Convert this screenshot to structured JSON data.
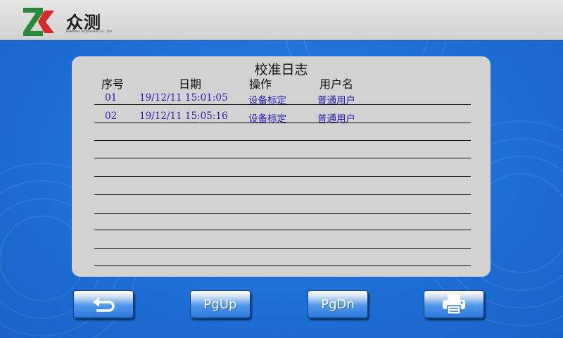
{
  "header": {
    "brand_name": "众测",
    "brand_sub": "PuMeiter Instrument Co., Ltd."
  },
  "panel": {
    "title": "校准日志",
    "columns": [
      "序号",
      "日期",
      "操作",
      "用户名"
    ],
    "rows": [
      {
        "no": "01",
        "date": "19/12/11 15:01:05",
        "op": "设备标定",
        "user": "普通用户"
      },
      {
        "no": "02",
        "date": "19/12/11 15:05:16",
        "op": "设备标定",
        "user": "普通用户"
      }
    ]
  },
  "buttons": {
    "back_icon": "back-arrow-icon",
    "pgup_label": "PgUp",
    "pgdn_label": "PgDn",
    "print_icon": "printer-icon"
  },
  "colors": {
    "background": "#1f6fd4",
    "panel": "#d2d2d2",
    "row_text": "#2a1fb0",
    "logo_green": "#2a8a3a",
    "logo_red": "#d62b2b"
  }
}
